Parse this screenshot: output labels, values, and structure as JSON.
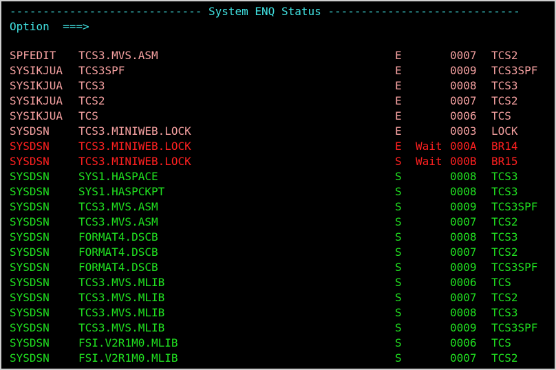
{
  "header": {
    "title": "System ENQ Status",
    "dashes_left": "----------------------------- ",
    "dashes_right": " -----------------------------"
  },
  "command": {
    "label": "Option",
    "arrow": "===>",
    "value": ""
  },
  "colors": {
    "header": "#40e0e0",
    "owned": "#f4a0a0",
    "wait": "#ff2020",
    "shared": "#20e020"
  },
  "enq_rows": [
    {
      "status": "owned",
      "major": "SPFEDIT",
      "minor": "TCS3.MVS.ASM",
      "scope": "E",
      "wait": "",
      "asid": "0007",
      "job": "TCS2"
    },
    {
      "status": "owned",
      "major": "SYSIKJUA",
      "minor": "TCS3SPF",
      "scope": "E",
      "wait": "",
      "asid": "0009",
      "job": "TCS3SPF"
    },
    {
      "status": "owned",
      "major": "SYSIKJUA",
      "minor": "TCS3",
      "scope": "E",
      "wait": "",
      "asid": "0008",
      "job": "TCS3"
    },
    {
      "status": "owned",
      "major": "SYSIKJUA",
      "minor": "TCS2",
      "scope": "E",
      "wait": "",
      "asid": "0007",
      "job": "TCS2"
    },
    {
      "status": "owned",
      "major": "SYSIKJUA",
      "minor": "TCS",
      "scope": "E",
      "wait": "",
      "asid": "0006",
      "job": "TCS"
    },
    {
      "status": "owned",
      "major": "SYSDSN",
      "minor": "TCS3.MINIWEB.LOCK",
      "scope": "E",
      "wait": "",
      "asid": "0003",
      "job": "LOCK"
    },
    {
      "status": "wait",
      "major": "SYSDSN",
      "minor": "TCS3.MINIWEB.LOCK",
      "scope": "E",
      "wait": "Wait",
      "asid": "000A",
      "job": "BR14"
    },
    {
      "status": "wait",
      "major": "SYSDSN",
      "minor": "TCS3.MINIWEB.LOCK",
      "scope": "S",
      "wait": "Wait",
      "asid": "000B",
      "job": "BR15"
    },
    {
      "status": "shared",
      "major": "SYSDSN",
      "minor": "SYS1.HASPACE",
      "scope": "S",
      "wait": "",
      "asid": "0008",
      "job": "TCS3"
    },
    {
      "status": "shared",
      "major": "SYSDSN",
      "minor": "SYS1.HASPCKPT",
      "scope": "S",
      "wait": "",
      "asid": "0008",
      "job": "TCS3"
    },
    {
      "status": "shared",
      "major": "SYSDSN",
      "minor": "TCS3.MVS.ASM",
      "scope": "S",
      "wait": "",
      "asid": "0009",
      "job": "TCS3SPF"
    },
    {
      "status": "shared",
      "major": "SYSDSN",
      "minor": "TCS3.MVS.ASM",
      "scope": "S",
      "wait": "",
      "asid": "0007",
      "job": "TCS2"
    },
    {
      "status": "shared",
      "major": "SYSDSN",
      "minor": "FORMAT4.DSCB",
      "scope": "S",
      "wait": "",
      "asid": "0008",
      "job": "TCS3"
    },
    {
      "status": "shared",
      "major": "SYSDSN",
      "minor": "FORMAT4.DSCB",
      "scope": "S",
      "wait": "",
      "asid": "0007",
      "job": "TCS2"
    },
    {
      "status": "shared",
      "major": "SYSDSN",
      "minor": "FORMAT4.DSCB",
      "scope": "S",
      "wait": "",
      "asid": "0009",
      "job": "TCS3SPF"
    },
    {
      "status": "shared",
      "major": "SYSDSN",
      "minor": "TCS3.MVS.MLIB",
      "scope": "S",
      "wait": "",
      "asid": "0006",
      "job": "TCS"
    },
    {
      "status": "shared",
      "major": "SYSDSN",
      "minor": "TCS3.MVS.MLIB",
      "scope": "S",
      "wait": "",
      "asid": "0007",
      "job": "TCS2"
    },
    {
      "status": "shared",
      "major": "SYSDSN",
      "minor": "TCS3.MVS.MLIB",
      "scope": "S",
      "wait": "",
      "asid": "0008",
      "job": "TCS3"
    },
    {
      "status": "shared",
      "major": "SYSDSN",
      "minor": "TCS3.MVS.MLIB",
      "scope": "S",
      "wait": "",
      "asid": "0009",
      "job": "TCS3SPF"
    },
    {
      "status": "shared",
      "major": "SYSDSN",
      "minor": "FSI.V2R1M0.MLIB",
      "scope": "S",
      "wait": "",
      "asid": "0006",
      "job": "TCS"
    },
    {
      "status": "shared",
      "major": "SYSDSN",
      "minor": "FSI.V2R1M0.MLIB",
      "scope": "S",
      "wait": "",
      "asid": "0007",
      "job": "TCS2"
    }
  ]
}
